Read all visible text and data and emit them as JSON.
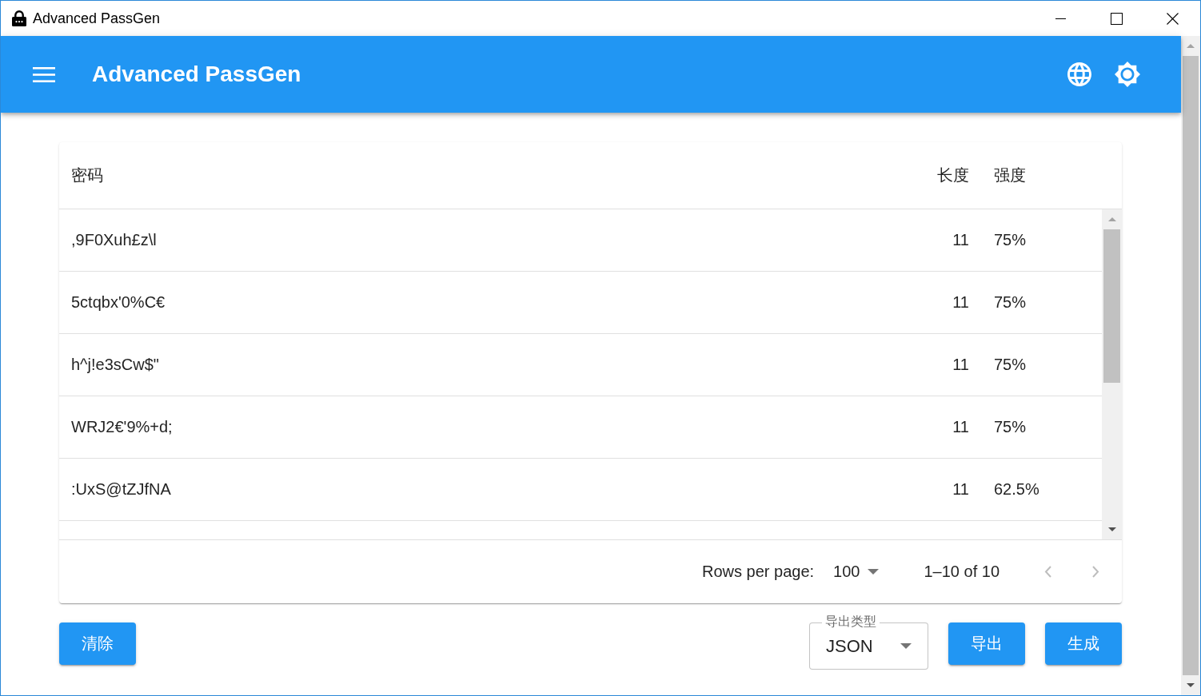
{
  "window": {
    "title": "Advanced PassGen"
  },
  "app_bar": {
    "title": "Advanced PassGen"
  },
  "table": {
    "columns": [
      {
        "label": "密码",
        "numeric": false
      },
      {
        "label": "长度",
        "numeric": true
      },
      {
        "label": "强度",
        "numeric": false
      }
    ],
    "rows": [
      {
        "cells": [
          ",9F0Xuh£z\\l",
          "11",
          "75%"
        ]
      },
      {
        "cells": [
          "5ctqbx'0%C€",
          "11",
          "75%"
        ]
      },
      {
        "cells": [
          "h^j!e3sCw$\"",
          "11",
          "75%"
        ]
      },
      {
        "cells": [
          "WRJ2€'9%+d;",
          "11",
          "75%"
        ]
      },
      {
        "cells": [
          ":UxS@tZJfNA",
          "11",
          "62.5%"
        ]
      }
    ],
    "pagination": {
      "rows_per_page_label": "Rows per page:",
      "rows_per_page": "100",
      "range": "1–10 of 10",
      "prev_page": {
        "disabled": true
      },
      "next_page": {
        "disabled": true
      }
    }
  },
  "actions": {
    "clear": "清除",
    "export_type": {
      "label": "导出类型",
      "value": "JSON"
    },
    "export": "导出",
    "generate": "生成"
  }
}
